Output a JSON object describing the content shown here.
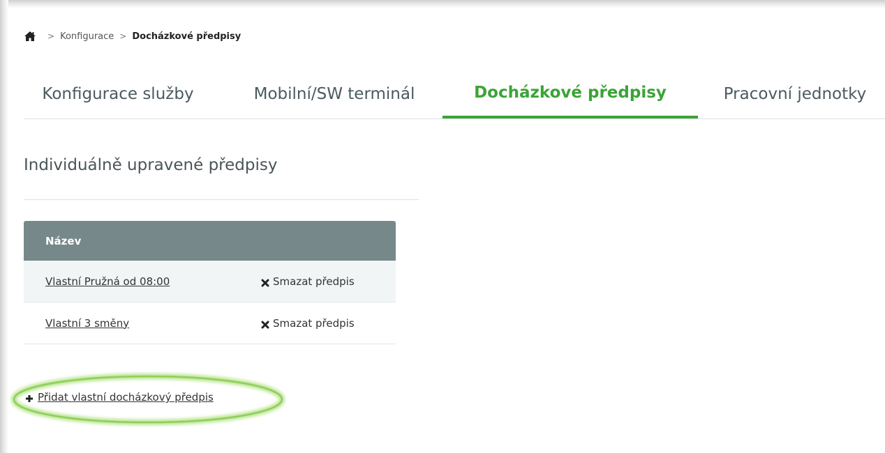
{
  "breadcrumb": {
    "home_icon": "home-icon",
    "items": [
      "Konfigurace"
    ],
    "current": "Docházkové předpisy"
  },
  "tabs": [
    {
      "label": "Konfigurace služby",
      "active": false
    },
    {
      "label": "Mobilní/SW terminál",
      "active": false
    },
    {
      "label": "Docházkové předpisy",
      "active": true
    },
    {
      "label": "Pracovní jednotky",
      "active": false
    }
  ],
  "section": {
    "title": "Individuálně upravené předpisy"
  },
  "table": {
    "header": "Název",
    "rows": [
      {
        "name": "Vlastní Pružná od 08:00",
        "action": "Smazat předpis"
      },
      {
        "name": "Vlastní 3 směny",
        "action": "Smazat předpis"
      }
    ]
  },
  "add_link": {
    "label": "Přidat vlastní docházkový předpis",
    "icon": "plus-icon"
  },
  "colors": {
    "accent": "#3aa436",
    "table_header": "#76888a",
    "highlight": "#9ed36a"
  }
}
